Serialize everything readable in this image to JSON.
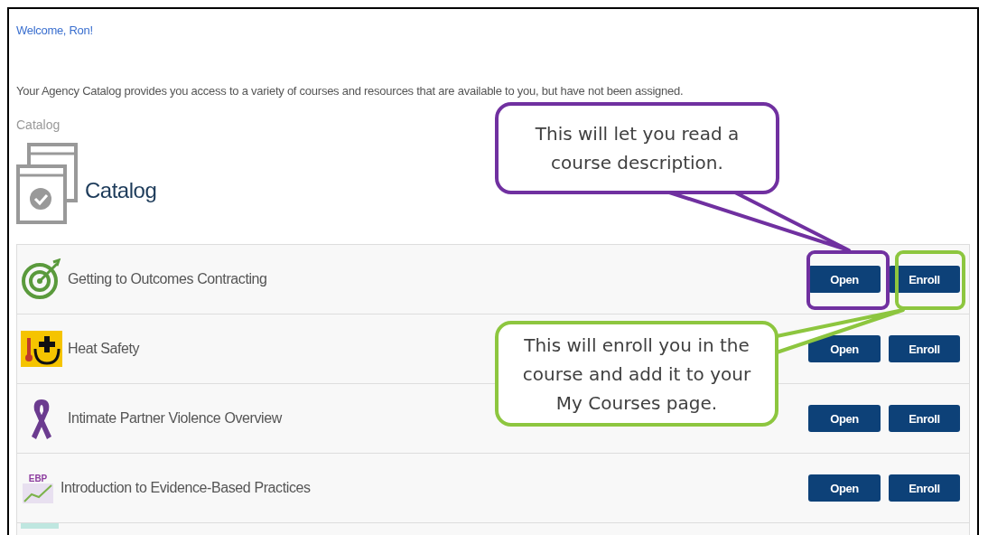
{
  "welcome": "Welcome, Ron!",
  "description": "Your Agency Catalog provides you access to a variety of courses and resources that are available to you, but have not been assigned.",
  "breadcrumb": "Catalog",
  "heading": "Catalog",
  "courses": [
    {
      "title": "Getting to Outcomes Contracting",
      "kind": "target",
      "open_label": "Open",
      "enroll_label": "Enroll"
    },
    {
      "title": "Heat Safety",
      "kind": "heat",
      "open_label": "Open",
      "enroll_label": "Enroll"
    },
    {
      "title": "Intimate Partner Violence Overview",
      "kind": "ribbon",
      "open_label": "Open",
      "enroll_label": "Enroll"
    },
    {
      "title": "Introduction to Evidence-Based Practices",
      "kind": "ebp",
      "icon_label": "EBP",
      "open_label": "Open",
      "enroll_label": "Enroll"
    },
    {
      "kind": "partial"
    }
  ],
  "callouts": [
    {
      "text": "This will let you read a course description.",
      "color": "#7030a0",
      "kind": "open"
    },
    {
      "text": "This will enroll you in the course and add it to your My Courses page.",
      "color": "#8dc63f",
      "kind": "enroll"
    }
  ]
}
